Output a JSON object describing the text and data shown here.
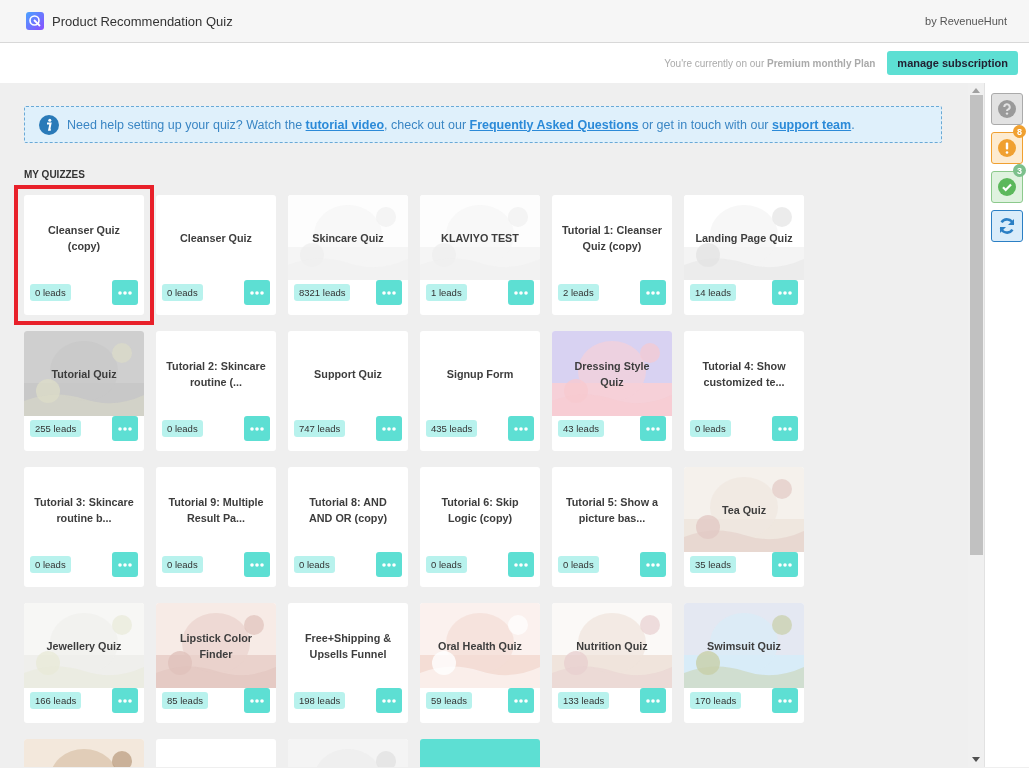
{
  "header": {
    "title": "Product Recommendation Quiz",
    "byline": "by RevenueHunt"
  },
  "plan_bar": {
    "notice": "You're currently on our **Premium monthly Plan**",
    "button": "manage subscription"
  },
  "help_banner": {
    "parts": [
      {
        "kind": "text",
        "text": "Need help setting up your quiz? Watch the "
      },
      {
        "kind": "link",
        "text": "tutorial video"
      },
      {
        "kind": "text",
        "text": ", check out our "
      },
      {
        "kind": "link",
        "text": "Frequently Asked Questions"
      },
      {
        "kind": "text",
        "text": " or get in touch with our "
      },
      {
        "kind": "link",
        "text": "support team"
      },
      {
        "kind": "text",
        "text": "."
      }
    ]
  },
  "section_title": "MY QUIZZES",
  "quizzes": [
    {
      "title": "Cleanser Quiz (copy)",
      "leads": "0 leads",
      "kind": "plain",
      "selected": true
    },
    {
      "title": "Cleanser Quiz",
      "leads": "0 leads",
      "kind": "plain",
      "selected": false
    },
    {
      "title": "Skincare Quiz",
      "leads": "8321 leads",
      "kind": "picture",
      "selected": false
    },
    {
      "title": "KLAVIYO TEST",
      "leads": "1 leads",
      "kind": "picture",
      "selected": false
    },
    {
      "title": "Tutorial 1: Cleanser Quiz (copy)",
      "leads": "2 leads",
      "kind": "plain",
      "selected": false
    },
    {
      "title": "Landing Page Quiz",
      "leads": "14 leads",
      "kind": "picture",
      "selected": false
    },
    {
      "title": "Tutorial Quiz",
      "leads": "255 leads",
      "kind": "picture",
      "selected": false
    },
    {
      "title": "Tutorial 2: Skincare routine (...",
      "leads": "0 leads",
      "kind": "plain",
      "selected": false
    },
    {
      "title": "Support Quiz",
      "leads": "747 leads",
      "kind": "plain",
      "selected": false
    },
    {
      "title": "Signup Form",
      "leads": "435 leads",
      "kind": "plain",
      "selected": false
    },
    {
      "title": "Dressing Style Quiz",
      "leads": "43 leads",
      "kind": "picture",
      "selected": false
    },
    {
      "title": "Tutorial 4: Show customized te...",
      "leads": "0 leads",
      "kind": "plain",
      "selected": false
    },
    {
      "title": "Tutorial 3: Skincare routine b...",
      "leads": "0 leads",
      "kind": "plain",
      "selected": false
    },
    {
      "title": "Tutorial 9: Multiple Result Pa...",
      "leads": "0 leads",
      "kind": "plain",
      "selected": false
    },
    {
      "title": "Tutorial 8: AND AND OR (copy)",
      "leads": "0 leads",
      "kind": "plain",
      "selected": false
    },
    {
      "title": "Tutorial 6: Skip Logic (copy)",
      "leads": "0 leads",
      "kind": "plain",
      "selected": false
    },
    {
      "title": "Tutorial 5: Show a picture bas...",
      "leads": "0 leads",
      "kind": "plain",
      "selected": false
    },
    {
      "title": "Tea Quiz",
      "leads": "35 leads",
      "kind": "picture",
      "selected": false
    },
    {
      "title": "Jewellery Quiz",
      "leads": "166 leads",
      "kind": "picture",
      "selected": false
    },
    {
      "title": "Lipstick Color Finder",
      "leads": "85 leads",
      "kind": "picture",
      "selected": false
    },
    {
      "title": "Free+Shipping & Upsells Funnel",
      "leads": "198 leads",
      "kind": "plain",
      "selected": false
    },
    {
      "title": "Oral Health Quiz",
      "leads": "59 leads",
      "kind": "picture",
      "selected": false
    },
    {
      "title": "Nutrition Quiz",
      "leads": "133 leads",
      "kind": "picture",
      "selected": false
    },
    {
      "title": "Swimsuit Quiz",
      "leads": "170 leads",
      "kind": "picture",
      "selected": false
    },
    {
      "kind": "picture",
      "selected": false
    },
    {
      "kind": "plain",
      "selected": false
    },
    {
      "kind": "picture",
      "selected": false
    },
    {
      "kind": "add",
      "selected": false
    }
  ],
  "sidebar": {
    "buttons": [
      {
        "kind": "help"
      },
      {
        "kind": "warning",
        "badge": "8"
      },
      {
        "kind": "success",
        "badge": "3"
      },
      {
        "kind": "refresh"
      }
    ]
  }
}
